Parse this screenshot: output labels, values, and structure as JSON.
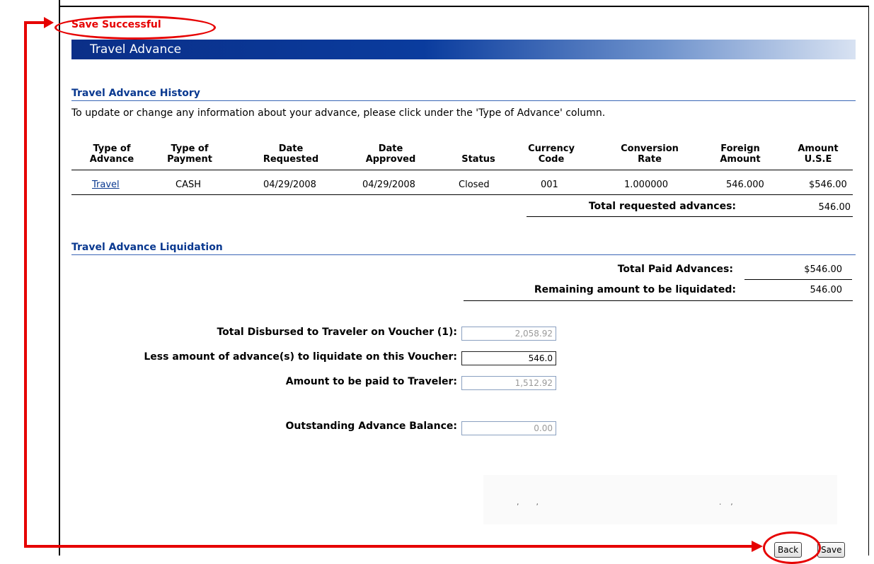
{
  "status_message": "Save Successful",
  "page_title": "Travel Advance",
  "history": {
    "heading": "Travel Advance History",
    "note": "To update or change any information about your advance, please click under the 'Type of Advance' column.",
    "columns": [
      [
        "Type of",
        "Advance"
      ],
      [
        "Type of",
        "Payment"
      ],
      [
        "Date",
        "Requested"
      ],
      [
        "Date",
        "Approved"
      ],
      [
        "",
        "Status"
      ],
      [
        "Currency",
        "Code"
      ],
      [
        "Conversion",
        "Rate"
      ],
      [
        "Foreign",
        "Amount"
      ],
      [
        "Amount",
        "U.S.E"
      ]
    ],
    "rows": [
      [
        "Travel",
        "CASH",
        "04/29/2008",
        "04/29/2008",
        "Closed",
        "001",
        "1.000000",
        "546.000",
        "$546.00"
      ]
    ],
    "total_label": "Total requested advances:",
    "total_value": "546.00"
  },
  "liquidation": {
    "heading": "Travel Advance Liquidation",
    "paid_label": "Total Paid Advances:",
    "paid_value": "$546.00",
    "remaining_label": "Remaining amount to be liquidated:",
    "remaining_value": "546.00",
    "fields": {
      "disbursed_label": "Total Disbursed to Traveler on Voucher (1):",
      "disbursed_value": "2,058.92",
      "liquidate_label": "Less amount of advance(s) to liquidate on this Voucher:",
      "liquidate_value": "546.0",
      "paid_traveler_label": "Amount to be paid to Traveler:",
      "paid_traveler_value": "1,512.92",
      "outstanding_label": "Outstanding Advance Balance:",
      "outstanding_value": "0.00"
    }
  },
  "buttons": {
    "back": "Back",
    "save": "Save"
  },
  "colors": {
    "annotation": "#e60000",
    "header_blue": "#0a3990",
    "title_bar": "#0b2f88"
  }
}
